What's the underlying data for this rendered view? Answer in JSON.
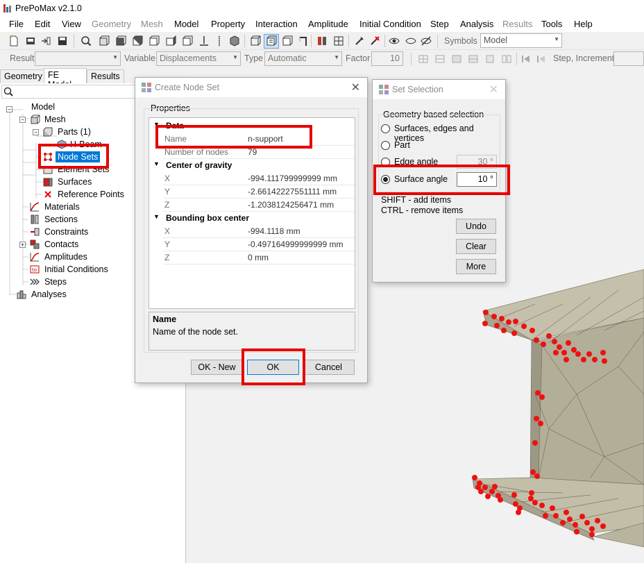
{
  "app": {
    "title": "PrePoMax v2.1.0"
  },
  "menu": [
    {
      "label": "File",
      "enabled": true
    },
    {
      "label": "Edit",
      "enabled": true
    },
    {
      "label": "View",
      "enabled": true
    },
    {
      "label": "Geometry",
      "enabled": false
    },
    {
      "label": "Mesh",
      "enabled": false
    },
    {
      "label": "Model",
      "enabled": true
    },
    {
      "label": "Property",
      "enabled": true
    },
    {
      "label": "Interaction",
      "enabled": true
    },
    {
      "label": "Amplitude",
      "enabled": true
    },
    {
      "label": "Initial Condition",
      "enabled": true
    },
    {
      "label": "Step",
      "enabled": true
    },
    {
      "label": "Analysis",
      "enabled": true
    },
    {
      "label": "Results",
      "enabled": false
    },
    {
      "label": "Tools",
      "enabled": true
    },
    {
      "label": "Help",
      "enabled": true
    }
  ],
  "toolbar1": {
    "symbols_label": "Symbols",
    "symbols_value": "Model"
  },
  "toolbar2": {
    "result_label": "Result",
    "result_value": "",
    "variable_label": "Variable",
    "variable_value": "Displacements",
    "type_label": "Type",
    "type_value": "Automatic",
    "factor_label": "Factor",
    "factor_value": "10",
    "step_label": "Step, Increment"
  },
  "left_tabs": [
    {
      "label": "Geometry",
      "active": false
    },
    {
      "label": "FE Model",
      "active": true
    },
    {
      "label": "Results",
      "active": false
    }
  ],
  "tree": {
    "model": "Model",
    "mesh": "Mesh",
    "parts": "Parts (1)",
    "part_item": "H-Beam",
    "node_sets": "Node Sets",
    "element_sets": "Element Sets",
    "surfaces": "Surfaces",
    "reference_points": "Reference Points",
    "materials": "Materials",
    "sections": "Sections",
    "constraints": "Constraints",
    "contacts": "Contacts",
    "amplitudes": "Amplitudes",
    "initial_conditions": "Initial Conditions",
    "steps": "Steps",
    "analyses": "Analyses"
  },
  "create_node_set": {
    "title": "Create Node Set",
    "group_label": "Properties",
    "cat_data": "Data",
    "name_key": "Name",
    "name_value": "n-support",
    "nodes_key": "Number of nodes",
    "nodes_value": "79",
    "cat_cog": "Center of gravity",
    "cog_x_key": "X",
    "cog_x": "-994.111799999999 mm",
    "cog_y_key": "Y",
    "cog_y": "-2.66142227551111 mm",
    "cog_z_key": "Z",
    "cog_z": "-1.2038124256471 mm",
    "cat_bbox": "Bounding box center",
    "bb_x_key": "X",
    "bb_x": "-994.1118 mm",
    "bb_y_key": "Y",
    "bb_y": "-0.497164999999999 mm",
    "bb_z_key": "Z",
    "bb_z": "0 mm",
    "desc_title": "Name",
    "desc_text": "Name of the node set.",
    "btn_ok_new": "OK - New",
    "btn_ok": "OK",
    "btn_cancel": "Cancel"
  },
  "set_selection": {
    "title": "Set Selection",
    "group_label": "Geometry based selection",
    "opt_surfaces": "Surfaces, edges and vertices",
    "opt_part": "Part",
    "opt_edge": "Edge angle",
    "edge_value": "30 °",
    "opt_surface": "Surface angle",
    "surface_value": "10 °",
    "selected_option": "Surface angle",
    "hint_shift": "SHIFT - add items",
    "hint_ctrl": "CTRL - remove items",
    "btn_undo": "Undo",
    "btn_clear": "Clear",
    "btn_more": "More"
  },
  "colors": {
    "highlight": "#e60000",
    "selection": "#0078d7",
    "mesh_fill": "#b2ae98",
    "node_dot": "#ee1111"
  }
}
